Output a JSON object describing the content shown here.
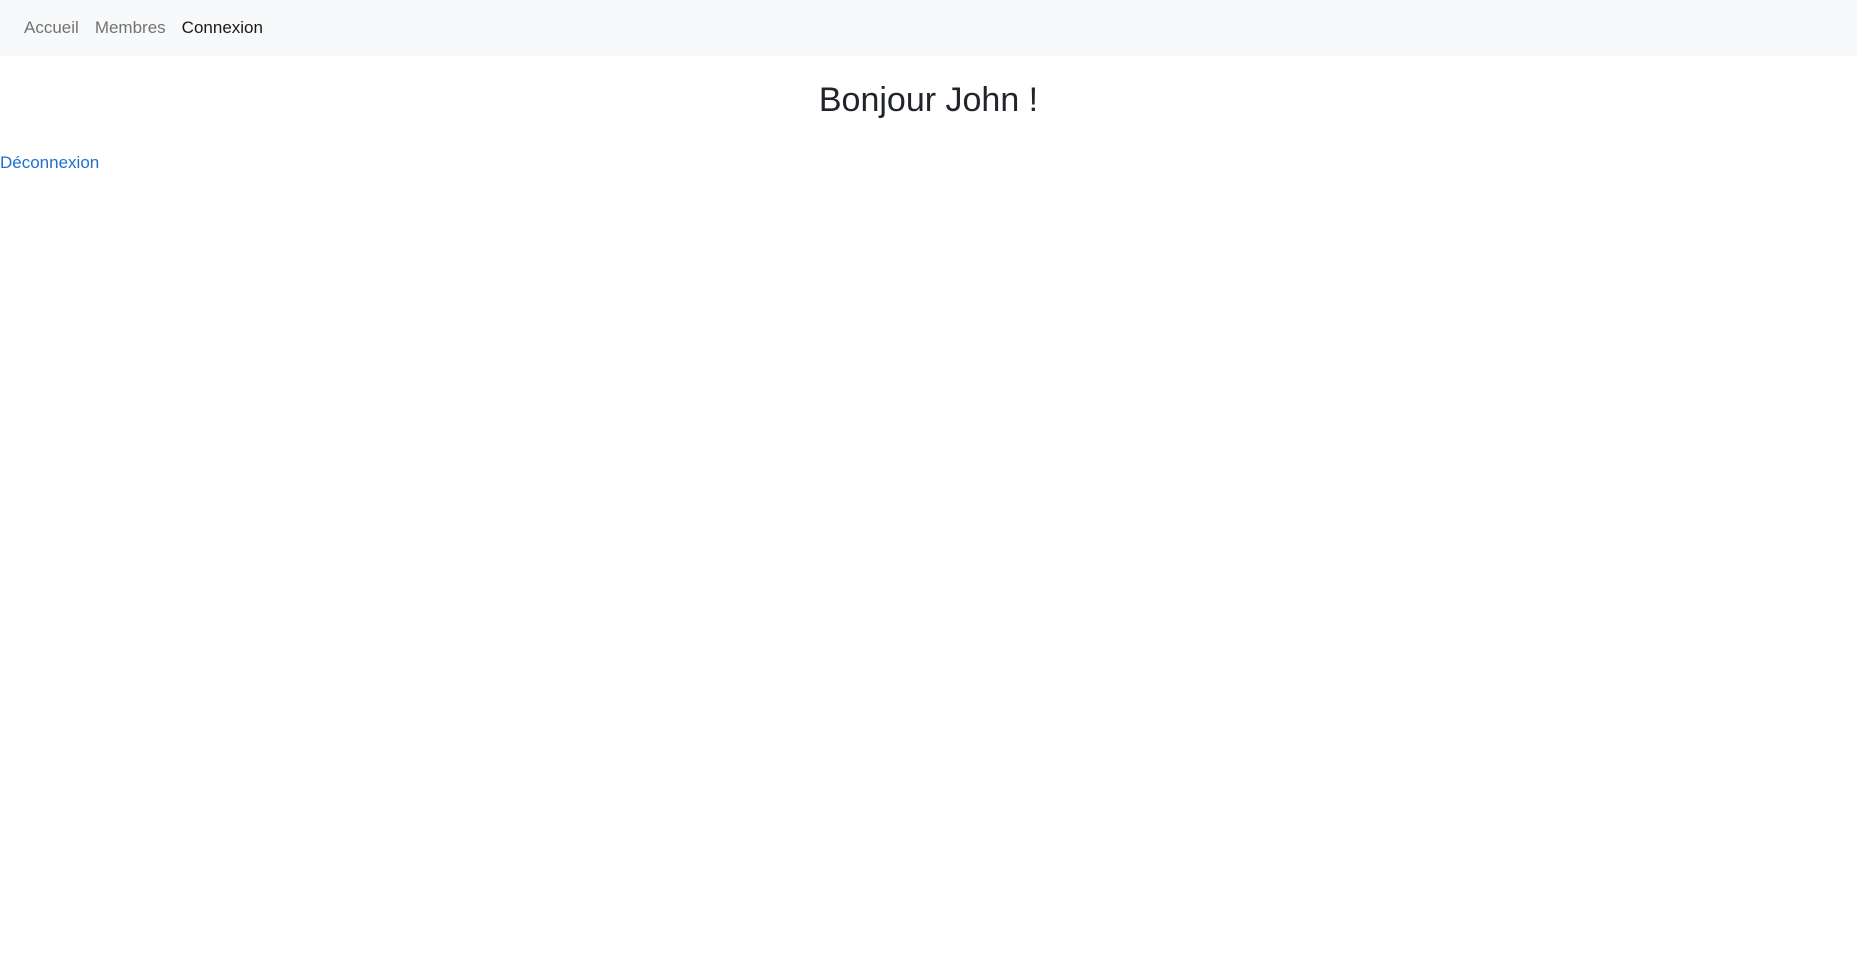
{
  "nav": {
    "items": [
      {
        "label": "Accueil",
        "active": false
      },
      {
        "label": "Membres",
        "active": false
      },
      {
        "label": "Connexion",
        "active": true
      }
    ]
  },
  "main": {
    "title": "Bonjour John !",
    "logout_label": "Déconnexion"
  },
  "colors": {
    "navbar_bg": "#f8f9fa",
    "link": "#1f6fcf",
    "text": "#212529"
  }
}
